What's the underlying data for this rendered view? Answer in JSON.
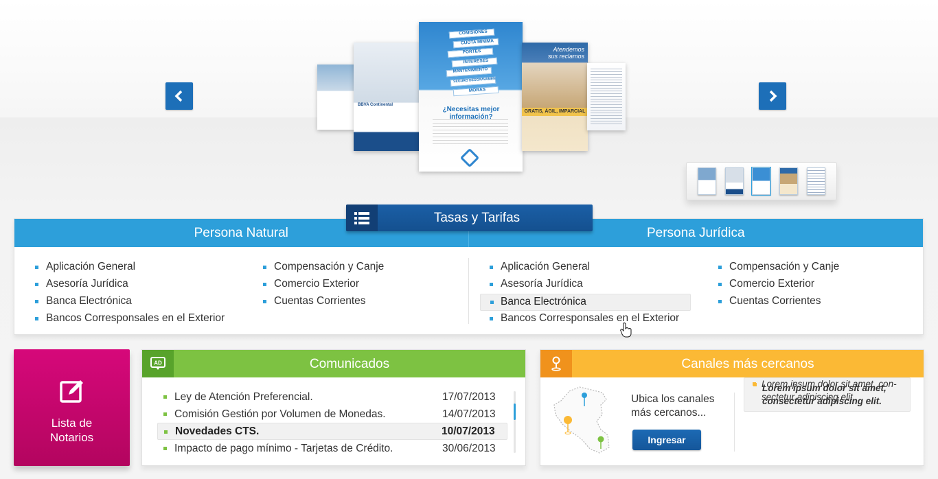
{
  "carousel": {
    "prev_icon": "chevron-left-icon",
    "next_icon": "chevron-right-icon",
    "posters": {
      "p2": {
        "heading": "BBVA Continental"
      },
      "p3": {
        "signs": [
          "COMISIONES",
          "CUOTA MINIMA",
          "PORTES",
          "INTERESES",
          "MANTENIMIENTO",
          "SEGURO DESGRAVAMEN",
          "MORAS"
        ],
        "question": "¿Necesitas mejor información?"
      },
      "p4": {
        "heading_1": "Atendemos",
        "heading_2": "sus reclamos",
        "band": "GRATIS, ÁGIL, IMPARCIAL"
      }
    },
    "thumbnails": 5
  },
  "tasas": {
    "icon": "list-icon",
    "title": "Tasas y Tarifas",
    "persona_natural": {
      "title": "Persona Natural",
      "col1": [
        "Aplicación General",
        "Asesoría Jurídica",
        "Banca Electrónica",
        "Bancos Corresponsales en el Exterior"
      ],
      "col2": [
        "Compensación y Canje",
        "Comercio Exterior",
        "Cuentas Corrientes"
      ]
    },
    "persona_juridica": {
      "title": "Persona Jurídica",
      "col1": [
        "Aplicación General",
        "Asesoría Jurídica",
        "Banca Electrónica",
        "Bancos Corresponsales en el Exterior"
      ],
      "col2": [
        "Compensación y Canje",
        "Comercio Exterior",
        "Cuentas Corrientes"
      ]
    }
  },
  "notarios": {
    "icon": "edit-icon",
    "line1": "Lista de",
    "line2": "Notarios",
    "color": "#c9066f"
  },
  "comunicados": {
    "icon": "ad-icon",
    "icon_text": "AD",
    "title": "Comunicados",
    "items": [
      {
        "text": "Ley de Atención Preferencial.",
        "date": "17/07/2013"
      },
      {
        "text": "Comisión Gestión por Volumen de Monedas.",
        "date": "14/07/2013"
      },
      {
        "text": "Novedades CTS.",
        "date": "10/07/2013"
      },
      {
        "text": "Impacto de pago mínimo - Tarjetas de Crédito.",
        "date": "30/06/2013"
      }
    ],
    "color": "#7dc242"
  },
  "canales": {
    "icon": "map-pin-icon",
    "title": "Canales más cercanos",
    "text_line1": "Ubica los canales",
    "text_line2": "más cercanos...",
    "button": "Ingresar",
    "lorem1": "Lorem ipsum dolor sit amet, consectetur adipiscing elit.",
    "lorem2": "Lorem ipsum dolor sit amet, con-sectetur adipiscing elit.",
    "color": "#fbb935"
  },
  "colors": {
    "primary_blue": "#2d9fda",
    "dark_blue": "#1b5fa6"
  }
}
